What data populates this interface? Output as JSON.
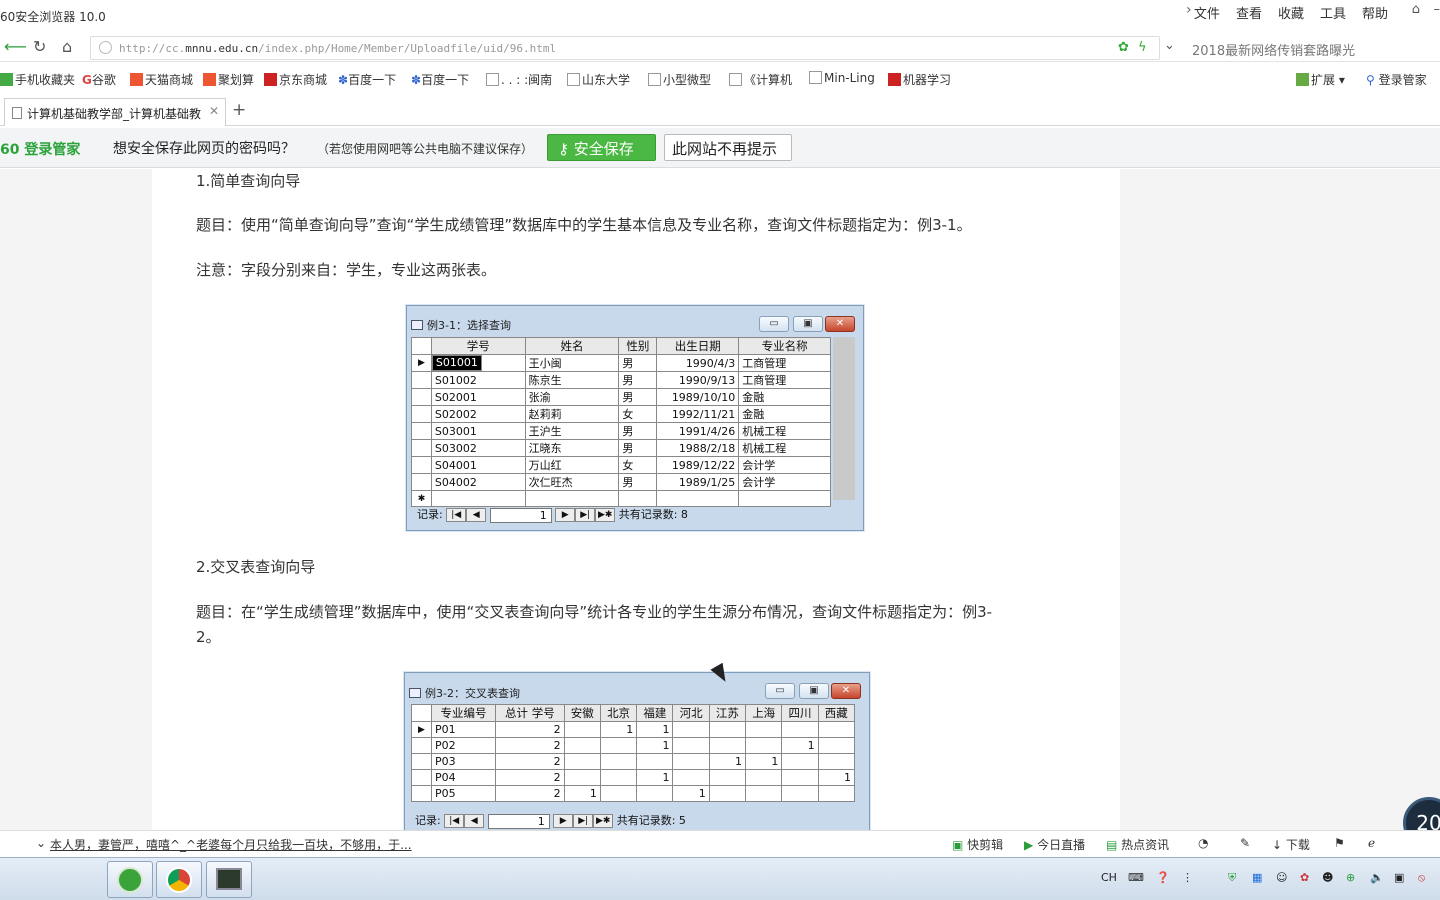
{
  "browser": {
    "title": "60安全浏览器 10.0",
    "menu": [
      "文件",
      "查看",
      "收藏",
      "工具",
      "帮助"
    ],
    "url_prefix": "http://cc.",
    "url_host": "mnnu.edu.cn",
    "url_path": "/index.php/Home/Member/Uploadfile/uid/96.html",
    "search_text": "2018最新网络传销套路曝光",
    "bookmarks": [
      "手机收藏夹",
      "谷歌",
      "天猫商城",
      "聚划算",
      "京东商城",
      "百度一下",
      "百度一下",
      ". . : :闽南",
      "山东大学",
      "小型微型",
      "《计算机",
      "Min-Ling",
      "机器学习"
    ],
    "ext_label": "扩展",
    "login_label": "登录管家",
    "tab_title": "计算机基础教学部_计算机基础教",
    "new_tab": "+"
  },
  "password_bar": {
    "logo": "60 登录管家",
    "question": "想安全保存此网页的密码吗？",
    "note": "（若您使用网吧等公共电脑不建议保存）",
    "save_label": "安全保存",
    "never_label": "此网站不再提示"
  },
  "content": {
    "h1": "1.简单查询向导",
    "p1": "题目：使用“简单查询向导”查询“学生成绩管理”数据库中的学生基本信息及专业名称，查询文件标题指定为：例3-1。",
    "p2": "注意：字段分别来自：学生，专业这两张表。",
    "h2": "2.交叉表查询向导",
    "p3a": "题目：在“学生成绩管理”数据库中，使用“交叉表查询向导”统计各专业的学生生源分布情况，查询文件标题指定为：例3-",
    "p3b": "2。"
  },
  "query1": {
    "title": "例3-1：选择查询",
    "columns": [
      "学号",
      "姓名",
      "性别",
      "出生日期",
      "专业名称"
    ],
    "rows": [
      [
        "S01001",
        "王小闽",
        "男",
        "1990/4/3",
        "工商管理"
      ],
      [
        "S01002",
        "陈京生",
        "男",
        "1990/9/13",
        "工商管理"
      ],
      [
        "S02001",
        "张渝",
        "男",
        "1989/10/10",
        "金融"
      ],
      [
        "S02002",
        "赵莉莉",
        "女",
        "1992/11/21",
        "金融"
      ],
      [
        "S03001",
        "王沪生",
        "男",
        "1991/4/26",
        "机械工程"
      ],
      [
        "S03002",
        "江晓东",
        "男",
        "1988/2/18",
        "机械工程"
      ],
      [
        "S04001",
        "万山红",
        "女",
        "1989/12/22",
        "会计学"
      ],
      [
        "S04002",
        "次仁旺杰",
        "男",
        "1989/1/25",
        "会计学"
      ]
    ],
    "record_label": "记录:",
    "record_value": "1",
    "total_label": "共有记录数: 8"
  },
  "query2": {
    "title": "例3-2：交叉表查询",
    "columns": [
      "专业编号",
      "总计 学号",
      "安徽",
      "北京",
      "福建",
      "河北",
      "江苏",
      "上海",
      "四川",
      "西藏"
    ],
    "rows": [
      [
        "P01",
        "2",
        "",
        "1",
        "1",
        "",
        "",
        "",
        "",
        ""
      ],
      [
        "P02",
        "2",
        "",
        "",
        "1",
        "",
        "",
        "",
        "1",
        ""
      ],
      [
        "P03",
        "2",
        "",
        "",
        "",
        "",
        "1",
        "1",
        "",
        ""
      ],
      [
        "P04",
        "2",
        "",
        "",
        "1",
        "",
        "",
        "",
        "",
        "1"
      ],
      [
        "P05",
        "2",
        "1",
        "",
        "",
        "1",
        "",
        "",
        "",
        ""
      ]
    ],
    "record_label": "记录:",
    "record_value": "1",
    "total_label": "共有记录数: 5"
  },
  "status": {
    "news": "本人男，妻管严，嘻嘻^_^老婆每个月只给我一百块，不够用，于...",
    "items": [
      "快剪辑",
      "今日直播",
      "热点资讯",
      "下载"
    ]
  },
  "taskbar": {
    "lang": "CH"
  },
  "overlay_badge": "20"
}
